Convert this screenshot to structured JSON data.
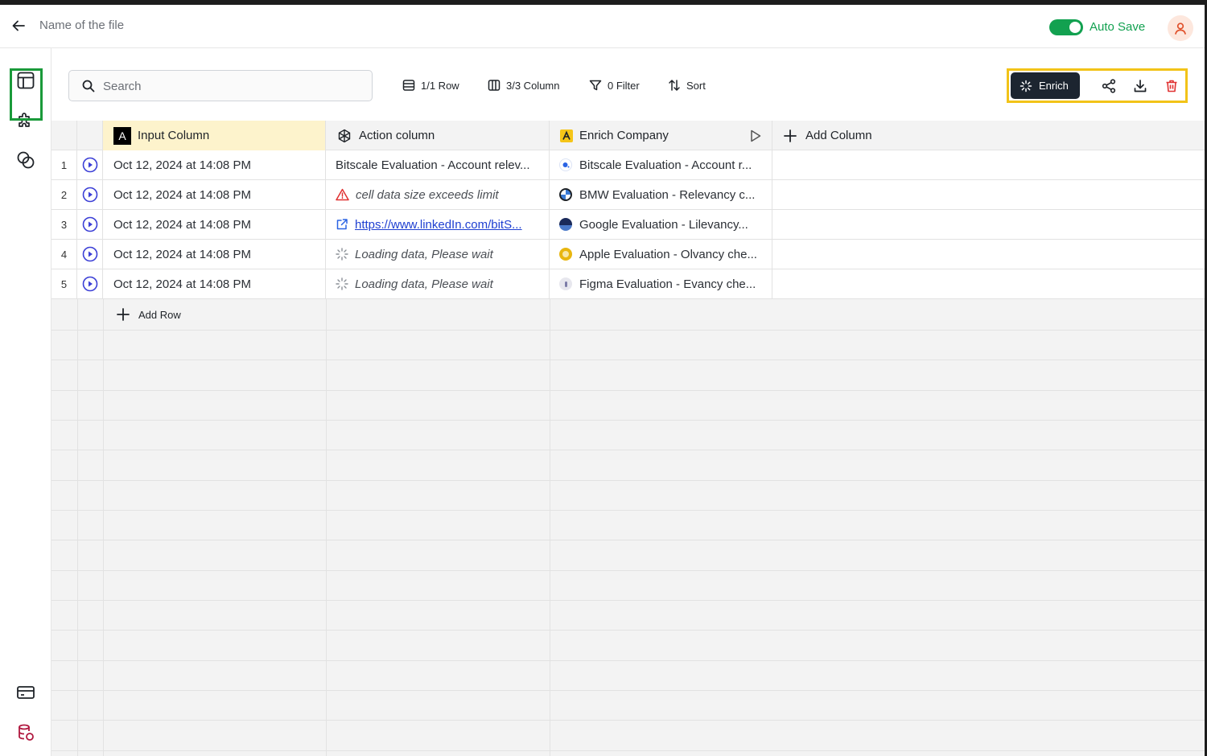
{
  "header": {
    "file_name": "Name of the file",
    "autosave_label": "Auto Save",
    "autosave_on": true
  },
  "toolbar": {
    "search_placeholder": "Search",
    "rows_label": "1/1 Row",
    "columns_label": "3/3 Column",
    "filter_label": "0 Filter",
    "sort_label": "Sort",
    "enrich_label": "Enrich"
  },
  "table": {
    "columns": {
      "input": "Input Column",
      "input_badge": "A",
      "action": "Action column",
      "enrich": "Enrich Company",
      "add": "Add Column"
    },
    "rows": [
      {
        "num": "1",
        "input": "Oct 12, 2024 at 14:08 PM",
        "action": "Bitscale Evaluation - Account relev...",
        "enrich": "Bitscale Evaluation - Account r..."
      },
      {
        "num": "2",
        "input": "Oct 12, 2024 at 14:08 PM",
        "action": "cell data size exceeds limit",
        "enrich": "BMW Evaluation - Relevancy c..."
      },
      {
        "num": "3",
        "input": "Oct 12, 2024 at 14:08 PM",
        "action": "https://www.linkedIn.com/bitS...",
        "enrich": "Google Evaluation - Lilevancy..."
      },
      {
        "num": "4",
        "input": "Oct 12, 2024 at 14:08 PM",
        "action": "Loading data, Please wait",
        "enrich": "Apple Evaluation - Olvancy che..."
      },
      {
        "num": "5",
        "input": "Oct 12, 2024 at 14:08 PM",
        "action": "Loading data, Please wait",
        "enrich": "Figma Evaluation - Evancy che..."
      }
    ],
    "add_row_label": "Add Row"
  },
  "colors": {
    "accent_green": "#12a150",
    "play_blue": "#3b3fd6",
    "warning_red": "#e03131",
    "link_blue": "#1e3fd1",
    "highlight_yellow": "#f2c318"
  }
}
